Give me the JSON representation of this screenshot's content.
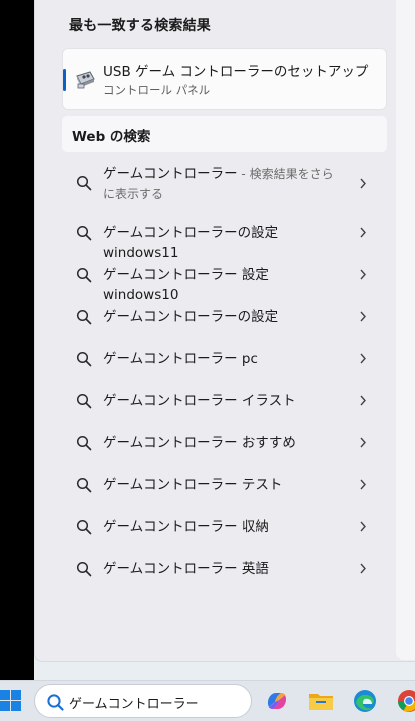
{
  "start_panel": {
    "best_match_title": "最も一致する検索結果",
    "best_match": {
      "title": "USB ゲーム コントローラーのセットアップ",
      "subtitle": "コントロール パネル"
    },
    "web_section_title": "Web の検索",
    "web_results": [
      {
        "text": "ゲームコントローラー",
        "suffix": " - 検索結果をさらに表示する"
      },
      {
        "text": "ゲームコントローラーの設定 windows11"
      },
      {
        "text": "ゲームコントローラー 設定 windows10"
      },
      {
        "text": "ゲームコントローラーの設定"
      },
      {
        "text": "ゲームコントローラー pc"
      },
      {
        "text": "ゲームコントローラー イラスト"
      },
      {
        "text": "ゲームコントローラー おすすめ"
      },
      {
        "text": "ゲームコントローラー テスト"
      },
      {
        "text": "ゲームコントローラー 収納"
      },
      {
        "text": "ゲームコントローラー 英語"
      }
    ]
  },
  "taskbar": {
    "search_value": "ゲームコントローラー",
    "pinned_icons": [
      "copilot-icon",
      "file-explorer-icon",
      "edge-icon",
      "chrome-icon"
    ]
  },
  "colors": {
    "accent": "#0a62c4",
    "panel_bg": "#ececf0",
    "taskbar_bg": "#e1e6ec"
  }
}
